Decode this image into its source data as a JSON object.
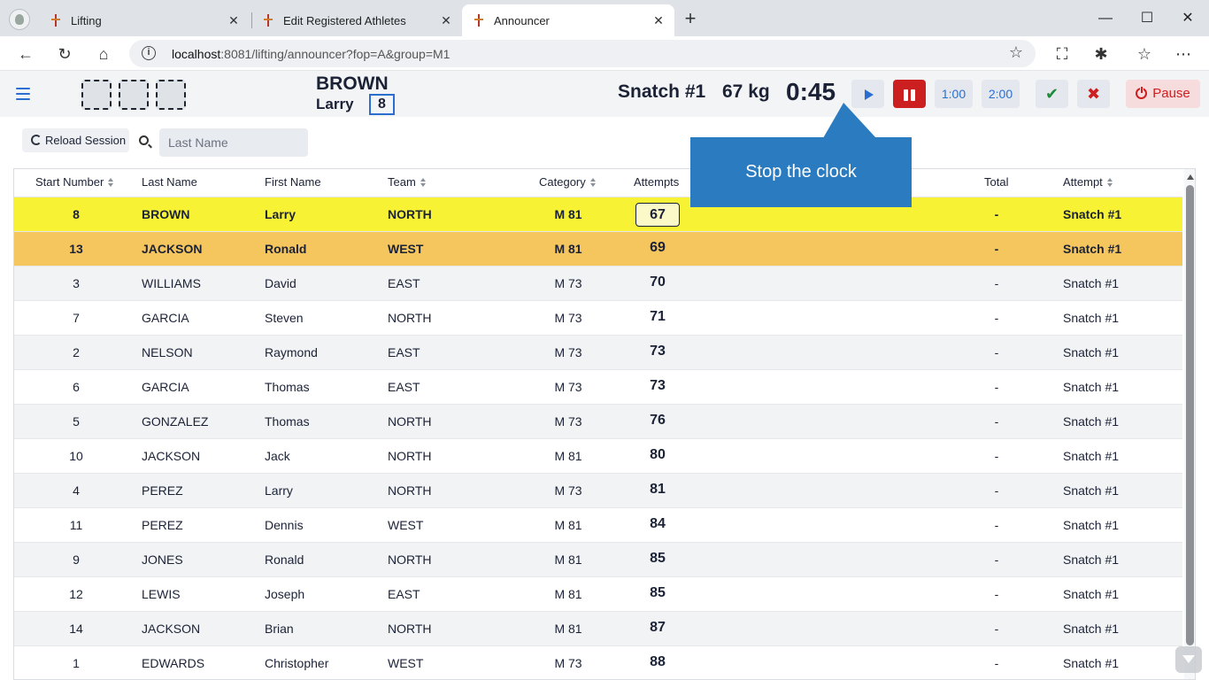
{
  "browser": {
    "tabs": [
      {
        "title": "Lifting",
        "close": "✕"
      },
      {
        "title": "Edit Registered Athletes",
        "close": "✕"
      },
      {
        "title": "Announcer",
        "close": "✕"
      }
    ],
    "new_tab": "+",
    "window": {
      "minimize": "—",
      "maximize": "☐",
      "close": "✕"
    },
    "url_host": "localhost",
    "url_rest": ":8081/lifting/announcer?fop=A&group=M1",
    "nav": {
      "back": "←",
      "reload": "↻",
      "home": "⌂"
    },
    "right_icons": {
      "screenshot": "⛶",
      "extensions": "✱",
      "favorites": "☆",
      "more": "⋯"
    }
  },
  "header": {
    "athlete_last": "BROWN",
    "athlete_first": "Larry",
    "athlete_number": "8",
    "lift_type": "Snatch #1",
    "weight": "67 kg",
    "clock": "0:45",
    "buttons": {
      "one_minute": "1:00",
      "two_minutes": "2:00",
      "good": "✔",
      "bad": "✖",
      "pause": "Pause"
    }
  },
  "filters": {
    "reload_label": "Reload Session",
    "last_name_placeholder": "Last Name"
  },
  "callout": {
    "text": "Stop the clock"
  },
  "grid": {
    "headers": {
      "start_number": "Start Number",
      "last_name": "Last Name",
      "first_name": "First Name",
      "team": "Team",
      "category": "Category",
      "attempts": "Attempts",
      "total": "Total",
      "attempt": "Attempt"
    },
    "rows": [
      {
        "start": "8",
        "last": "BROWN",
        "first": "Larry",
        "team": "NORTH",
        "cat": "M 81",
        "att": "67",
        "total": "-",
        "attempt": "Snatch #1"
      },
      {
        "start": "13",
        "last": "JACKSON",
        "first": "Ronald",
        "team": "WEST",
        "cat": "M 81",
        "att": "69",
        "total": "-",
        "attempt": "Snatch #1"
      },
      {
        "start": "3",
        "last": "WILLIAMS",
        "first": "David",
        "team": "EAST",
        "cat": "M 73",
        "att": "70",
        "total": "-",
        "attempt": "Snatch #1"
      },
      {
        "start": "7",
        "last": "GARCIA",
        "first": "Steven",
        "team": "NORTH",
        "cat": "M 73",
        "att": "71",
        "total": "-",
        "attempt": "Snatch #1"
      },
      {
        "start": "2",
        "last": "NELSON",
        "first": "Raymond",
        "team": "EAST",
        "cat": "M 73",
        "att": "73",
        "total": "-",
        "attempt": "Snatch #1"
      },
      {
        "start": "6",
        "last": "GARCIA",
        "first": "Thomas",
        "team": "EAST",
        "cat": "M 73",
        "att": "73",
        "total": "-",
        "attempt": "Snatch #1"
      },
      {
        "start": "5",
        "last": "GONZALEZ",
        "first": "Thomas",
        "team": "NORTH",
        "cat": "M 73",
        "att": "76",
        "total": "-",
        "attempt": "Snatch #1"
      },
      {
        "start": "10",
        "last": "JACKSON",
        "first": "Jack",
        "team": "NORTH",
        "cat": "M 81",
        "att": "80",
        "total": "-",
        "attempt": "Snatch #1"
      },
      {
        "start": "4",
        "last": "PEREZ",
        "first": "Larry",
        "team": "NORTH",
        "cat": "M 73",
        "att": "81",
        "total": "-",
        "attempt": "Snatch #1"
      },
      {
        "start": "11",
        "last": "PEREZ",
        "first": "Dennis",
        "team": "WEST",
        "cat": "M 81",
        "att": "84",
        "total": "-",
        "attempt": "Snatch #1"
      },
      {
        "start": "9",
        "last": "JONES",
        "first": "Ronald",
        "team": "NORTH",
        "cat": "M 81",
        "att": "85",
        "total": "-",
        "attempt": "Snatch #1"
      },
      {
        "start": "12",
        "last": "LEWIS",
        "first": "Joseph",
        "team": "EAST",
        "cat": "M 81",
        "att": "85",
        "total": "-",
        "attempt": "Snatch #1"
      },
      {
        "start": "14",
        "last": "JACKSON",
        "first": "Brian",
        "team": "NORTH",
        "cat": "M 81",
        "att": "87",
        "total": "-",
        "attempt": "Snatch #1"
      },
      {
        "start": "1",
        "last": "EDWARDS",
        "first": "Christopher",
        "team": "WEST",
        "cat": "M 73",
        "att": "88",
        "total": "-",
        "attempt": "Snatch #1"
      }
    ]
  },
  "colors": {
    "current_row": "#f7f234",
    "next_row": "#f5c55e",
    "accent": "#2a6fd0",
    "stop": "#cc1f1f",
    "callout": "#2b7bc1"
  }
}
